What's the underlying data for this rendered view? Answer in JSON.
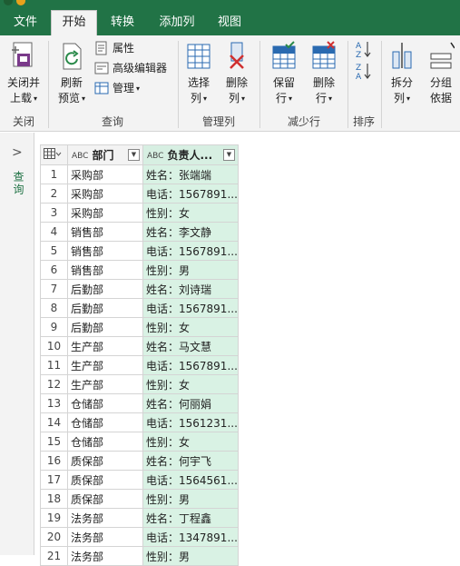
{
  "tabs": {
    "file": "文件",
    "home": "开始",
    "transform": "转换",
    "add_column": "添加列",
    "view": "视图"
  },
  "ribbon": {
    "close_load": [
      "关闭并",
      "上载"
    ],
    "refresh_preview": [
      "刷新",
      "预览"
    ],
    "properties": "属性",
    "advanced_editor": "高级编辑器",
    "manage": "管理",
    "choose_columns": [
      "选择",
      "列"
    ],
    "remove_columns": [
      "删除",
      "列"
    ],
    "keep_rows": [
      "保留",
      "行"
    ],
    "remove_rows": [
      "删除",
      "行"
    ],
    "split_column": [
      "拆分",
      "列"
    ],
    "group_by": [
      "分组",
      "依据"
    ],
    "groups": {
      "close": "关闭",
      "query": "查询",
      "manage_columns": "管理列",
      "reduce_rows": "减少行",
      "sort": "排序"
    }
  },
  "sidebar": {
    "query_label": "查询"
  },
  "table": {
    "headers": [
      "部门",
      "负责人..."
    ],
    "type_label": "ABC",
    "rows": [
      {
        "n": "1",
        "dept": "采购部",
        "info": "姓名：张端端"
      },
      {
        "n": "2",
        "dept": "采购部",
        "info": "电话：1567891..."
      },
      {
        "n": "3",
        "dept": "采购部",
        "info": "性别：女"
      },
      {
        "n": "4",
        "dept": "销售部",
        "info": "姓名：李文静"
      },
      {
        "n": "5",
        "dept": "销售部",
        "info": "电话：1567891..."
      },
      {
        "n": "6",
        "dept": "销售部",
        "info": "性别：男"
      },
      {
        "n": "7",
        "dept": "后勤部",
        "info": "姓名：刘诗瑞"
      },
      {
        "n": "8",
        "dept": "后勤部",
        "info": "电话：1567891..."
      },
      {
        "n": "9",
        "dept": "后勤部",
        "info": "性别：女"
      },
      {
        "n": "10",
        "dept": "生产部",
        "info": "姓名：马文慧"
      },
      {
        "n": "11",
        "dept": "生产部",
        "info": "电话：1567891..."
      },
      {
        "n": "12",
        "dept": "生产部",
        "info": "性别：女"
      },
      {
        "n": "13",
        "dept": "仓储部",
        "info": "姓名：何丽娟"
      },
      {
        "n": "14",
        "dept": "仓储部",
        "info": "电话：1561231..."
      },
      {
        "n": "15",
        "dept": "仓储部",
        "info": "性别：女"
      },
      {
        "n": "16",
        "dept": "质保部",
        "info": "姓名：何宇飞"
      },
      {
        "n": "17",
        "dept": "质保部",
        "info": "电话：1564561..."
      },
      {
        "n": "18",
        "dept": "质保部",
        "info": "性别：男"
      },
      {
        "n": "19",
        "dept": "法务部",
        "info": "姓名：丁程鑫"
      },
      {
        "n": "20",
        "dept": "法务部",
        "info": "电话：1347891..."
      },
      {
        "n": "21",
        "dept": "法务部",
        "info": "性别：男"
      }
    ]
  },
  "colors": {
    "accent": "#217346",
    "selected_column": "#d9f2e4"
  },
  "icons": {
    "close_load": "close-load-icon",
    "refresh": "refresh-icon",
    "properties": "properties-icon",
    "advanced_editor": "advanced-editor-icon",
    "manage": "manage-icon",
    "choose_columns": "choose-columns-icon",
    "remove_columns": "remove-columns-icon",
    "keep_rows": "keep-rows-icon",
    "remove_rows": "remove-rows-icon",
    "sort": "sort-icon",
    "split": "split-column-icon",
    "group": "group-by-icon",
    "chevron": "chevron-right-icon",
    "table": "table-icon",
    "filter": "filter-dropdown-icon"
  }
}
